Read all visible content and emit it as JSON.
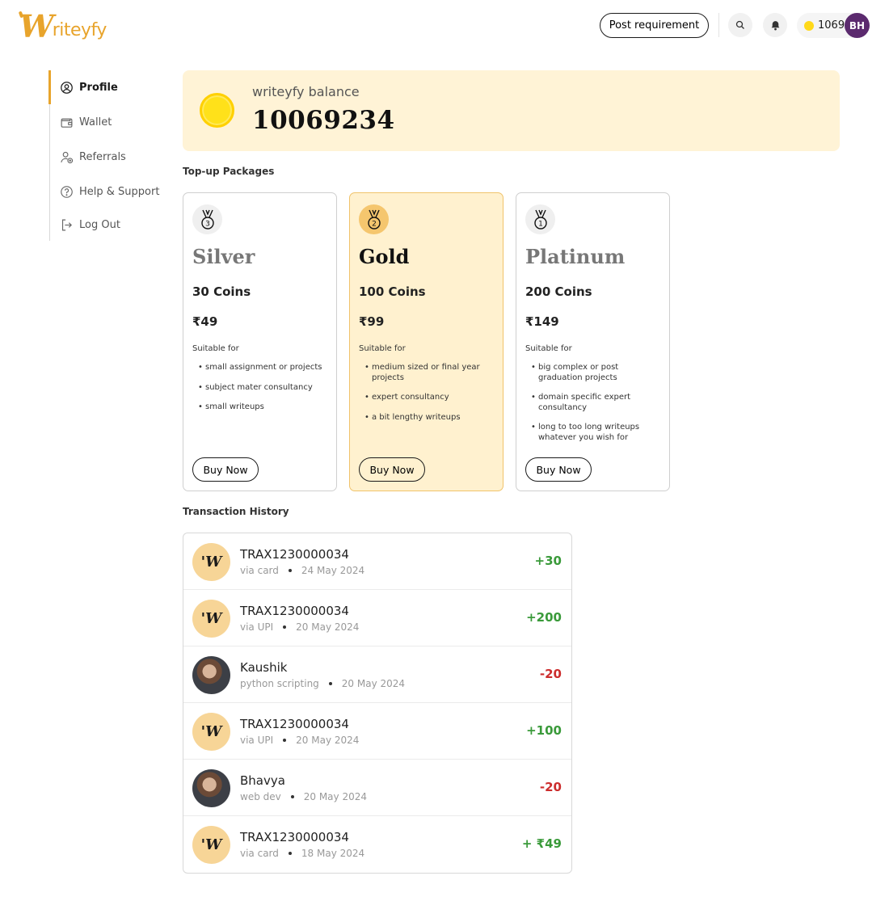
{
  "header": {
    "logo_initial": "W",
    "logo_rest": "riteyfy",
    "post_requirement_label": "Post requirement",
    "coin_count": "1069",
    "avatar_initials": "BH",
    "icons": [
      "search-icon",
      "bell-icon",
      "coin-icon"
    ]
  },
  "sidebar": {
    "items": [
      {
        "label": "Profile",
        "icon": "user-circle-icon",
        "active": true
      },
      {
        "label": "Wallet",
        "icon": "wallet-icon",
        "active": false
      },
      {
        "label": "Referrals",
        "icon": "user-plus-icon",
        "active": false
      },
      {
        "label": "Help & Support",
        "icon": "help-circle-icon",
        "active": false
      },
      {
        "label": "Log Out",
        "icon": "logout-icon",
        "active": false
      }
    ]
  },
  "balance": {
    "label": "writeyfy balance",
    "value": "10069234"
  },
  "packages_title": "Top-up Packages",
  "packages": [
    {
      "medal": "3",
      "name": "Silver",
      "coins": "30 Coins",
      "price": "₹49",
      "suitable_label": "Suitable for",
      "features": [
        "small assignment or projects",
        "subject mater consultancy",
        "small writeups"
      ],
      "buy_label": "Buy Now"
    },
    {
      "medal": "2",
      "name": "Gold",
      "coins": "100 Coins",
      "price": "₹99",
      "suitable_label": "Suitable for",
      "features": [
        "medium sized or final year projects",
        "expert consultancy",
        "a bit lengthy writeups"
      ],
      "buy_label": "Buy Now"
    },
    {
      "medal": "1",
      "name": "Platinum",
      "coins": "200 Coins",
      "price": "₹149",
      "suitable_label": "Suitable for",
      "features": [
        "big complex or post graduation projects",
        "domain specific expert consultancy",
        "long to too long writeups whatever you wish for"
      ],
      "buy_label": "Buy Now"
    }
  ],
  "transactions_title": "Transaction History",
  "transactions": [
    {
      "avatar": "writeyfy",
      "title": "TRAX1230000034",
      "method": "via card",
      "date": "24 May 2024",
      "amount": "+30",
      "type": "credit"
    },
    {
      "avatar": "writeyfy",
      "title": "TRAX1230000034",
      "method": "via UPI",
      "date": "20 May 2024",
      "amount": "+200",
      "type": "credit"
    },
    {
      "avatar": "person",
      "title": "Kaushik",
      "method": "python scripting",
      "date": "20 May 2024",
      "amount": "-20",
      "type": "debit"
    },
    {
      "avatar": "writeyfy",
      "title": "TRAX1230000034",
      "method": "via UPI",
      "date": "20 May 2024",
      "amount": "+100",
      "type": "credit"
    },
    {
      "avatar": "person",
      "title": "Bhavya",
      "method": "web dev",
      "date": "20 May 2024",
      "amount": "-20",
      "type": "debit"
    },
    {
      "avatar": "writeyfy",
      "title": "TRAX1230000034",
      "method": "via card",
      "date": "18 May 2024",
      "amount": "+ ₹49",
      "type": "credit"
    }
  ],
  "colors": {
    "brand": "#E8A42C",
    "balance_bg": "#FFF3D6",
    "gold_card_bg": "#FFF1CF",
    "credit": "#3a9a3a",
    "debit": "#cc2d2d",
    "coin": "#FFD91A"
  }
}
